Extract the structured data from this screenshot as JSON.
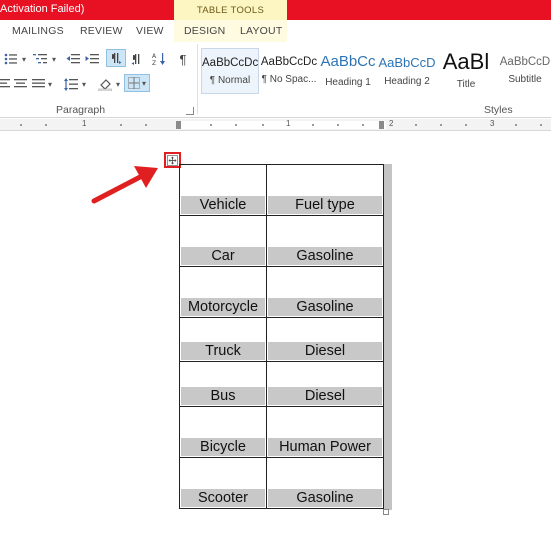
{
  "window": {
    "title": "Activation Failed)",
    "context_group": "TABLE TOOLS"
  },
  "tabs": [
    {
      "label": "MAILINGS"
    },
    {
      "label": "REVIEW"
    },
    {
      "label": "VIEW"
    },
    {
      "label": "DESIGN"
    },
    {
      "label": "LAYOUT"
    }
  ],
  "ribbon": {
    "paragraph_group_label": "Paragraph",
    "styles_group_label": "Styles",
    "styles": [
      {
        "preview": "AaBbCcDc",
        "name": "¶ Normal",
        "selected": true
      },
      {
        "preview": "AaBbCcDc",
        "name": "¶ No Spac...",
        "selected": false
      },
      {
        "preview": "AaBbCc",
        "name": "Heading 1",
        "selected": false
      },
      {
        "preview": "AaBbCcD",
        "name": "Heading 2",
        "selected": false
      },
      {
        "preview": "AaBl",
        "name": "Title",
        "selected": false
      },
      {
        "preview": "AaBbCcD",
        "name": "Subtitle",
        "selected": false
      }
    ]
  },
  "ruler": {
    "labels": [
      "1",
      "1",
      "2",
      "3"
    ]
  },
  "table": {
    "rows": [
      [
        "Vehicle",
        "Fuel type"
      ],
      [
        "Car",
        "Gasoline"
      ],
      [
        "Motorcycle",
        "Gasoline"
      ],
      [
        "Truck",
        "Diesel"
      ],
      [
        "Bus",
        "Diesel"
      ],
      [
        "Bicycle",
        "Human Power"
      ],
      [
        "Scooter",
        "Gasoline"
      ]
    ]
  },
  "colors": {
    "title_bar": "#e81123",
    "context_tab": "#fdf6c3",
    "annotation": "#e02020",
    "cell_shading": "#c8c8c8"
  }
}
